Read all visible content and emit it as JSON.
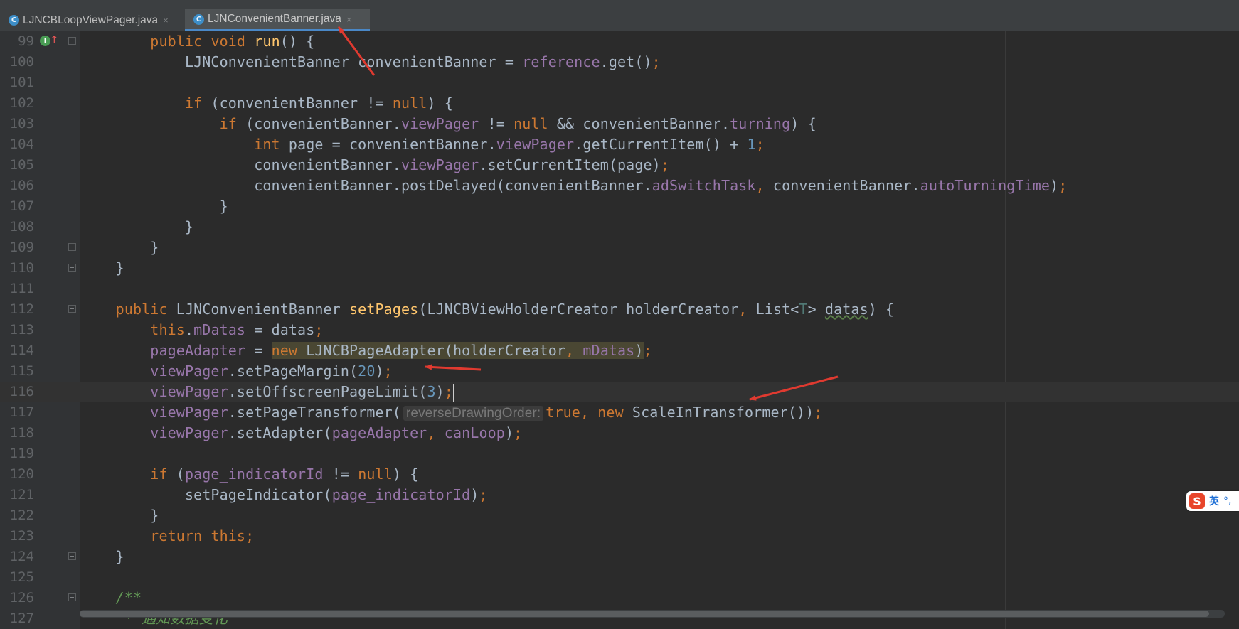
{
  "editor": {
    "tabs": [
      {
        "label": "LJNCBLoopViewPager.java",
        "icon": "class-icon",
        "active": false
      },
      {
        "label": "LJNConvenientBanner.java",
        "icon": "class-icon",
        "active": true
      }
    ],
    "close_glyph": "×",
    "class_icon_letter": "C",
    "gutter_marker": "I",
    "gutter_marker_arrow": "↑"
  },
  "lines": [
    {
      "n": "99"
    },
    {
      "n": "100"
    },
    {
      "n": "101"
    },
    {
      "n": "102"
    },
    {
      "n": "103"
    },
    {
      "n": "104"
    },
    {
      "n": "105"
    },
    {
      "n": "106"
    },
    {
      "n": "107"
    },
    {
      "n": "108"
    },
    {
      "n": "109"
    },
    {
      "n": "110"
    },
    {
      "n": "111"
    },
    {
      "n": "112"
    },
    {
      "n": "113"
    },
    {
      "n": "114"
    },
    {
      "n": "115"
    },
    {
      "n": "116"
    },
    {
      "n": "117"
    },
    {
      "n": "118"
    },
    {
      "n": "119"
    },
    {
      "n": "120"
    },
    {
      "n": "121"
    },
    {
      "n": "122"
    },
    {
      "n": "123"
    },
    {
      "n": "124"
    },
    {
      "n": "125"
    },
    {
      "n": "126"
    },
    {
      "n": "127"
    }
  ],
  "code": {
    "l99": {
      "i": "        ",
      "kw1": "public",
      "kw2": "void",
      "fn": "run",
      "rest": "() {"
    },
    "l100": {
      "i": "            ",
      "a": "LJNConvenientBanner convenientBanner = ",
      "fld": "reference",
      "b": ".get()",
      "semi": ";"
    },
    "l102": {
      "i": "            ",
      "kw": "if",
      "a": " (convenientBanner != ",
      "kw2": "null",
      "b": ") {"
    },
    "l103": {
      "i": "                ",
      "kw": "if",
      "a": " (convenientBanner.",
      "f1": "viewPager",
      "b": " != ",
      "kw2": "null",
      "c": " && convenientBanner.",
      "f2": "turning",
      "d": ") {"
    },
    "l104": {
      "i": "                    ",
      "kw": "int",
      "a": " page = convenientBanner.",
      "f1": "viewPager",
      "b": ".getCurrentItem() + ",
      "num": "1",
      "semi": ";"
    },
    "l105": {
      "i": "                    ",
      "a": "convenientBanner.",
      "f1": "viewPager",
      "b": ".setCurrentItem(page)",
      "semi": ";"
    },
    "l106": {
      "i": "                    ",
      "a": "convenientBanner.postDelayed(convenientBanner.",
      "f1": "adSwitchTask",
      "comma": ",",
      "b": " convenientBanner.",
      "f2": "autoTurningTime",
      "c": ")",
      "semi": ";"
    },
    "l107": {
      "i": "                ",
      "a": "}"
    },
    "l108": {
      "i": "            ",
      "a": "}"
    },
    "l109": {
      "i": "        ",
      "a": "}"
    },
    "l110": {
      "i": "    ",
      "a": "}"
    },
    "l112": {
      "i": "    ",
      "kw": "public",
      "a": " LJNConvenientBanner ",
      "fn": "setPages",
      "b": "(LJNCBViewHolderCreator holderCreator",
      "comma": ",",
      "c": " List<",
      "gen": "T",
      "d": "> ",
      "e": "datas",
      "f": ") {"
    },
    "l113": {
      "i": "        ",
      "kw": "this",
      "a": ".",
      "f1": "mDatas",
      "b": " = datas",
      "semi": ";"
    },
    "l114": {
      "i": "        ",
      "f1": "pageAdapter",
      "a": " = ",
      "kw": "new",
      "b": " LJNCBPageAdapter(holderCreator",
      "comma": ",",
      "f2": " mDatas",
      "c": ")",
      "semi": ";"
    },
    "l115": {
      "i": "        ",
      "f1": "viewPager",
      "a": ".setPageMargin(",
      "num": "20",
      "b": ")",
      "semi": ";"
    },
    "l116": {
      "i": "        ",
      "f1": "viewPager",
      "a": ".setOffscreenPageLimit(",
      "num": "3",
      "b": ")",
      "semi": ";"
    },
    "l117": {
      "i": "        ",
      "f1": "viewPager",
      "a": ".setPageTransformer(",
      "hint": "reverseDrawingOrder:",
      "kw": "true",
      "comma": ",",
      "kw2": " new",
      "b": " ScaleInTransformer())",
      "semi": ";"
    },
    "l118": {
      "i": "        ",
      "f1": "viewPager",
      "a": ".setAdapter(",
      "f2": "pageAdapter",
      "comma": ",",
      "f3": " canLoop",
      "b": ")",
      "semi": ";"
    },
    "l120": {
      "i": "        ",
      "kw": "if",
      "a": " (",
      "f1": "page_indicatorId",
      "b": " != ",
      "kw2": "null",
      "c": ") {"
    },
    "l121": {
      "i": "            ",
      "a": "setPageIndicator(",
      "f1": "page_indicatorId",
      "b": ")",
      "semi": ";"
    },
    "l122": {
      "i": "        ",
      "a": "}"
    },
    "l123": {
      "i": "        ",
      "kw": "return",
      "a": " ",
      "kw2": "this",
      "semi": ";"
    },
    "l124": {
      "i": "    ",
      "a": "}"
    },
    "l126": {
      "i": "    ",
      "cmt": "/**"
    },
    "l127": {
      "i": "     ",
      "cmt": "* 通知数据变化"
    }
  },
  "ime": {
    "logo": "S",
    "lang": "英",
    "punc": "°,"
  },
  "colors": {
    "background": "#2b2b2b",
    "gutter": "#313335",
    "keyword": "#cc7832",
    "field": "#9876aa",
    "method": "#ffc66d",
    "number": "#6897bb",
    "comment": "#629755",
    "text": "#a9b7c6",
    "annotation": "#e03a30"
  }
}
